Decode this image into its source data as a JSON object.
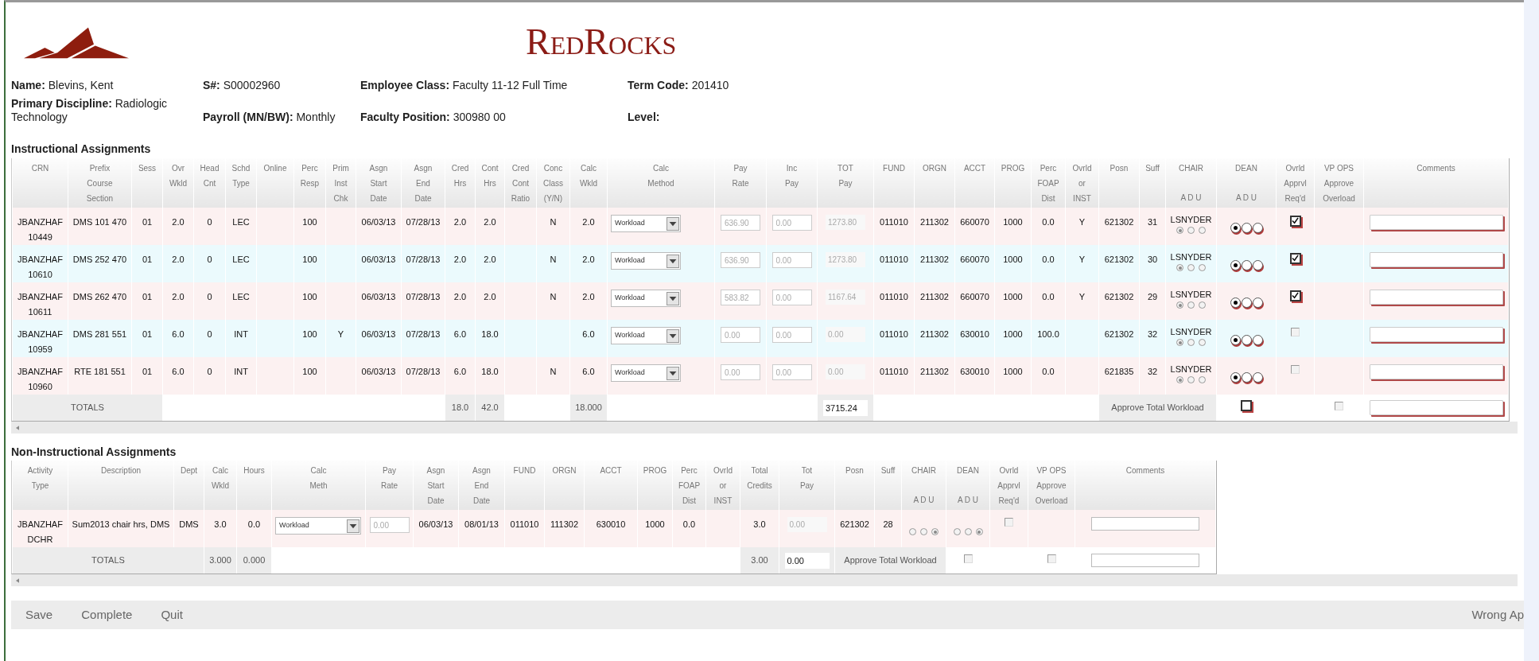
{
  "brand": {
    "name": "RedRocks"
  },
  "info": [
    {
      "label": "Name:",
      "value": "Blevins, Kent"
    },
    {
      "label": "S#:",
      "value": "S00002960"
    },
    {
      "label": "Employee Class:",
      "value": "Faculty 11-12 Full Time"
    },
    {
      "label": "Term Code:",
      "value": "201410"
    },
    {
      "label": "Primary Discipline:",
      "value": "Radiologic Technology"
    },
    {
      "label": "Payroll (MN/BW):",
      "value": "Monthly"
    },
    {
      "label": "Faculty Position:",
      "value": "300980 00"
    },
    {
      "label": "Level:"
    }
  ],
  "instructional": {
    "title": "Instructional Assignments",
    "columns": [
      {
        "head": [
          "CRN"
        ]
      },
      {
        "head": [
          "Prefix",
          "Course",
          "Section"
        ]
      },
      {
        "head": [
          "Sess"
        ]
      },
      {
        "head": [
          "Ovr",
          "Wkld"
        ]
      },
      {
        "head": [
          "Head",
          "Cnt"
        ]
      },
      {
        "head": [
          "Schd",
          "Type"
        ]
      },
      {
        "head": [
          "Online"
        ]
      },
      {
        "head": [
          "Perc",
          "Resp"
        ]
      },
      {
        "head": [
          "Prim",
          "Inst",
          "Chk"
        ]
      },
      {
        "head": [
          "Asgn",
          "Start",
          "Date"
        ]
      },
      {
        "head": [
          "Asgn",
          "End",
          "Date"
        ]
      },
      {
        "head": [
          "Cred",
          "Hrs"
        ]
      },
      {
        "head": [
          "Cont",
          "Hrs"
        ]
      },
      {
        "head": [
          "Cred",
          "Cont",
          "Ratio"
        ]
      },
      {
        "head": [
          "Conc",
          "Class",
          "(Y/N)"
        ]
      },
      {
        "head": [
          "Calc",
          "Wkld"
        ]
      },
      {
        "head": [
          "Calc",
          "Method"
        ]
      },
      {
        "head": [
          "Pay",
          "Rate"
        ]
      },
      {
        "head": [
          "Inc",
          "Pay"
        ]
      },
      {
        "head": [
          "TOT",
          "Pay"
        ]
      },
      {
        "head": [
          "FUND"
        ]
      },
      {
        "head": [
          "ORGN"
        ]
      },
      {
        "head": [
          "ACCT"
        ]
      },
      {
        "head": [
          "PROG"
        ]
      },
      {
        "head": [
          "Perc",
          "FOAP",
          "Dist"
        ]
      },
      {
        "head": [
          "Ovrld",
          "or",
          "INST"
        ]
      },
      {
        "head": [
          "Posn"
        ]
      },
      {
        "head": [
          "Suff"
        ]
      },
      {
        "head": [
          "CHAIR"
        ],
        "sub": "A D U"
      },
      {
        "head": [
          "DEAN"
        ],
        "sub": "A D U"
      },
      {
        "head": [
          "Ovrld",
          "Apprvl",
          "Req'd"
        ]
      },
      {
        "head": [
          "VP OPS",
          "Approve",
          "Overload"
        ]
      },
      {
        "head": [
          "Comments"
        ]
      }
    ],
    "rows": [
      {
        "cells": [
          "JBANZHAF 10449",
          "DMS 101 470",
          "01",
          "2.0",
          "0",
          "LEC",
          null,
          "100",
          null,
          "06/03/13",
          "07/28/13",
          "2.0",
          "2.0",
          null,
          "N",
          "2.0",
          "Workload",
          "636.90",
          "0.00",
          "1273.80",
          "011010",
          "211302",
          "660070",
          "1000",
          "0.0",
          "Y",
          "621302",
          "31",
          {
            "name": "LSNYDER",
            "radios": [
              {
                "selected": true
              },
              {
                "selected": false
              },
              {
                "selected": false
              }
            ]
          },
          {
            "radios": [
              {
                "selected": true
              },
              {
                "selected": false
              },
              {
                "selected": false
              }
            ]
          },
          {
            "checked": true,
            "disabled": false
          },
          null,
          null
        ]
      },
      {
        "cells": [
          "JBANZHAF 10610",
          "DMS 252 470",
          "01",
          "2.0",
          "0",
          "LEC",
          null,
          "100",
          null,
          "06/03/13",
          "07/28/13",
          "2.0",
          "2.0",
          null,
          "N",
          "2.0",
          "Workload",
          "636.90",
          "0.00",
          "1273.80",
          "011010",
          "211302",
          "660070",
          "1000",
          "0.0",
          "Y",
          "621302",
          "30",
          {
            "name": "LSNYDER",
            "radios": [
              {
                "selected": true
              },
              {
                "selected": false
              },
              {
                "selected": false
              }
            ]
          },
          {
            "radios": [
              {
                "selected": true
              },
              {
                "selected": false
              },
              {
                "selected": false
              }
            ]
          },
          {
            "checked": true,
            "disabled": false
          },
          null,
          null
        ]
      },
      {
        "cells": [
          "JBANZHAF 10611",
          "DMS 262 470",
          "01",
          "2.0",
          "0",
          "LEC",
          null,
          "100",
          null,
          "06/03/13",
          "07/28/13",
          "2.0",
          "2.0",
          null,
          "N",
          "2.0",
          "Workload",
          "583.82",
          "0.00",
          "1167.64",
          "011010",
          "211302",
          "660070",
          "1000",
          "0.0",
          "Y",
          "621302",
          "29",
          {
            "name": "LSNYDER",
            "radios": [
              {
                "selected": true
              },
              {
                "selected": false
              },
              {
                "selected": false
              }
            ]
          },
          {
            "radios": [
              {
                "selected": true
              },
              {
                "selected": false
              },
              {
                "selected": false
              }
            ]
          },
          {
            "checked": true,
            "disabled": false
          },
          null,
          null
        ]
      },
      {
        "cells": [
          "JBANZHAF 10959",
          "DMS 281 551",
          "01",
          "6.0",
          "0",
          "INT",
          null,
          "100",
          "Y",
          "06/03/13",
          "07/28/13",
          "6.0",
          "18.0",
          null,
          null,
          "6.0",
          "Workload",
          "0.00",
          "0.00",
          "0.00",
          "011010",
          "211302",
          "630010",
          "1000",
          "100.0",
          null,
          "621302",
          "32",
          {
            "name": "LSNYDER",
            "radios": [
              {
                "selected": true
              },
              {
                "selected": false
              },
              {
                "selected": false
              }
            ]
          },
          {
            "radios": [
              {
                "selected": true
              },
              {
                "selected": false
              },
              {
                "selected": false
              }
            ]
          },
          {
            "checked": false,
            "disabled": true
          },
          null,
          null
        ]
      },
      {
        "cells": [
          "JBANZHAF 10960",
          "RTE 181 551",
          "01",
          "6.0",
          "0",
          "INT",
          null,
          "100",
          null,
          "06/03/13",
          "07/28/13",
          "6.0",
          "18.0",
          null,
          "N",
          "6.0",
          "Workload",
          "0.00",
          "0.00",
          "0.00",
          "011010",
          "211302",
          "630010",
          "1000",
          "0.0",
          null,
          "621835",
          "32",
          {
            "name": "LSNYDER",
            "radios": [
              {
                "selected": true
              },
              {
                "selected": false
              },
              {
                "selected": false
              }
            ]
          },
          {
            "radios": [
              {
                "selected": true
              },
              {
                "selected": false
              },
              {
                "selected": false
              }
            ]
          },
          {
            "checked": false,
            "disabled": true
          },
          null,
          null
        ]
      }
    ],
    "totals": [
      {
        "kind": "label",
        "text": "TOTALS"
      },
      {
        "kind": "blank"
      },
      {
        "kind": "value",
        "text": "18.0"
      },
      {
        "kind": "value",
        "text": "42.0"
      },
      {
        "kind": "blank"
      },
      {
        "kind": "value",
        "text": "18.000"
      },
      {
        "kind": "blank"
      },
      {
        "kind": "field",
        "text": "3715.24"
      },
      {
        "kind": "blank"
      },
      {
        "kind": "label",
        "text": "Approve Total Workload"
      },
      {
        "kind": "checkbox",
        "checked": false,
        "disabled": false
      },
      {
        "kind": "blank"
      },
      {
        "kind": "checkbox",
        "checked": false,
        "disabled": true
      },
      {
        "kind": "comment"
      }
    ]
  },
  "non_instructional": {
    "title": "Non-Instructional Assignments",
    "columns": [
      {
        "head": [
          "Activity",
          "Type"
        ]
      },
      {
        "head": [
          "Description"
        ]
      },
      {
        "head": [
          "Dept"
        ]
      },
      {
        "head": [
          "Calc",
          "Wkld"
        ]
      },
      {
        "head": [
          "Hours"
        ]
      },
      {
        "head": [
          "Calc",
          "Meth"
        ]
      },
      {
        "head": [
          "Pay",
          "Rate"
        ]
      },
      {
        "head": [
          "Asgn",
          "Start",
          "Date"
        ]
      },
      {
        "head": [
          "Asgn",
          "End",
          "Date"
        ]
      },
      {
        "head": [
          "FUND"
        ]
      },
      {
        "head": [
          "ORGN"
        ]
      },
      {
        "head": [
          "ACCT"
        ]
      },
      {
        "head": [
          "PROG"
        ]
      },
      {
        "head": [
          "Perc",
          "FOAP",
          "Dist"
        ]
      },
      {
        "head": [
          "Ovrld",
          "or",
          "INST"
        ]
      },
      {
        "head": [
          "Total",
          "Credits"
        ]
      },
      {
        "head": [
          "Tot",
          "Pay"
        ]
      },
      {
        "head": [
          "Posn"
        ]
      },
      {
        "head": [
          "Suff"
        ]
      },
      {
        "head": [
          "CHAIR"
        ],
        "sub": "A D U"
      },
      {
        "head": [
          "DEAN"
        ],
        "sub": "A D U"
      },
      {
        "head": [
          "Ovrld",
          "Apprvl",
          "Req'd"
        ]
      },
      {
        "head": [
          "VP OPS",
          "Approve",
          "Overload"
        ]
      },
      {
        "head": [
          "Comments"
        ]
      }
    ],
    "rows": [
      {
        "cells": [
          "JBANZHAF DCHR",
          "Sum2013 chair hrs, DMS",
          "DMS",
          "3.0",
          "0.0",
          "Workload",
          "0.00",
          "06/03/13",
          "08/01/13",
          "011010",
          "111302",
          "630010",
          "1000",
          "0.0",
          null,
          "3.0",
          "0.00",
          "621302",
          "28",
          {
            "radios": [
              {
                "selected": false
              },
              {
                "selected": false
              },
              {
                "selected": true
              }
            ]
          },
          {
            "radios": [
              {
                "selected": false
              },
              {
                "selected": false
              },
              {
                "selected": true
              }
            ]
          },
          {
            "checked": false,
            "disabled": true
          },
          null,
          null
        ]
      }
    ],
    "totals": [
      {
        "kind": "label",
        "text": "TOTALS"
      },
      {
        "kind": "value",
        "text": "3.000"
      },
      {
        "kind": "value",
        "text": "0.000"
      },
      {
        "kind": "blank"
      },
      {
        "kind": "value",
        "text": "3.00"
      },
      {
        "kind": "field",
        "text": "0.00"
      },
      {
        "kind": "label",
        "text": "Approve Total Workload"
      },
      {
        "kind": "checkbox",
        "checked": false,
        "disabled": true
      },
      {
        "kind": "blank"
      },
      {
        "kind": "checkbox",
        "checked": false,
        "disabled": true
      },
      {
        "kind": "comment"
      }
    ]
  },
  "actions": [
    {
      "label": "Save"
    },
    {
      "label": "Complete"
    },
    {
      "label": "Quit"
    }
  ],
  "status_text": "Wrong Ap"
}
